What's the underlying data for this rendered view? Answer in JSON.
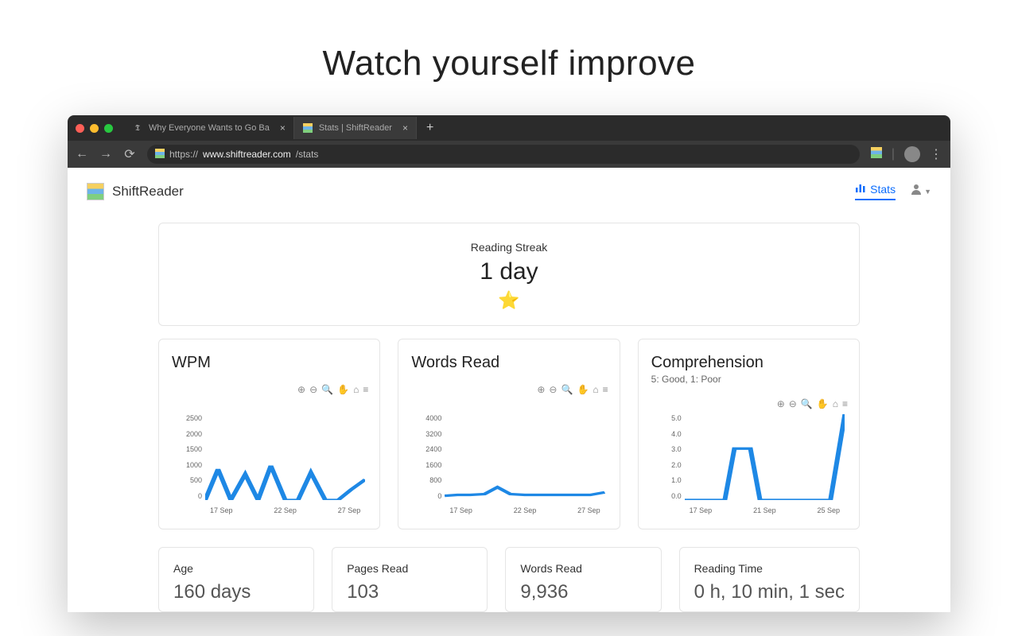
{
  "headline": "Watch yourself improve",
  "browser": {
    "tabs": [
      {
        "title": "Why Everyone Wants to Go Ba",
        "active": false
      },
      {
        "title": "Stats | ShiftReader",
        "active": true
      }
    ],
    "url_prefix": "https://",
    "url_host": "www.shiftreader.com",
    "url_path": "/stats"
  },
  "app": {
    "brand": "ShiftReader",
    "nav_stats": "Stats"
  },
  "streak": {
    "label": "Reading Streak",
    "value": "1 day",
    "star": "⭐"
  },
  "charts": {
    "wpm": {
      "title": "WPM",
      "y_ticks": [
        "2500",
        "2000",
        "1500",
        "1000",
        "500",
        "0"
      ],
      "x_ticks": [
        "17 Sep",
        "22 Sep",
        "27 Sep"
      ]
    },
    "words": {
      "title": "Words Read",
      "y_ticks": [
        "4000",
        "3200",
        "2400",
        "1600",
        "800",
        "0"
      ],
      "x_ticks": [
        "17 Sep",
        "22 Sep",
        "27 Sep"
      ]
    },
    "comp": {
      "title": "Comprehension",
      "subtitle": "5: Good, 1: Poor",
      "y_ticks": [
        "5.0",
        "4.0",
        "3.0",
        "2.0",
        "1.0",
        "0.0"
      ],
      "x_ticks": [
        "17 Sep",
        "21 Sep",
        "25 Sep"
      ]
    }
  },
  "chart_data": [
    {
      "type": "line",
      "title": "WPM",
      "ylabel": "",
      "ylim": [
        0,
        2500
      ],
      "x": [
        "17 Sep",
        "18 Sep",
        "19 Sep",
        "20 Sep",
        "21 Sep",
        "22 Sep",
        "23 Sep",
        "24 Sep",
        "25 Sep",
        "26 Sep",
        "27 Sep",
        "28 Sep",
        "29 Sep"
      ],
      "values": [
        0,
        900,
        0,
        750,
        0,
        1000,
        0,
        0,
        800,
        0,
        0,
        300,
        600
      ]
    },
    {
      "type": "line",
      "title": "Words Read",
      "ylabel": "",
      "ylim": [
        0,
        4000
      ],
      "x": [
        "17 Sep",
        "18 Sep",
        "19 Sep",
        "20 Sep",
        "21 Sep",
        "22 Sep",
        "23 Sep",
        "24 Sep",
        "25 Sep",
        "26 Sep",
        "27 Sep",
        "28 Sep",
        "29 Sep"
      ],
      "values": [
        200,
        250,
        250,
        300,
        600,
        300,
        250,
        250,
        250,
        250,
        250,
        250,
        350
      ]
    },
    {
      "type": "line",
      "title": "Comprehension",
      "ylabel": "",
      "ylim": [
        0,
        5
      ],
      "x": [
        "17 Sep",
        "18 Sep",
        "19 Sep",
        "20 Sep",
        "21 Sep",
        "22 Sep",
        "23 Sep",
        "24 Sep",
        "25 Sep",
        "26 Sep",
        "27 Sep",
        "28 Sep",
        "29 Sep"
      ],
      "values": [
        0,
        0,
        0,
        0,
        3.0,
        3.0,
        0,
        0,
        0,
        0,
        0,
        0,
        5.0
      ]
    }
  ],
  "stats": {
    "age": {
      "label": "Age",
      "value": "160 days"
    },
    "pages": {
      "label": "Pages Read",
      "value": "103"
    },
    "words": {
      "label": "Words Read",
      "value": "9,936"
    },
    "time": {
      "label": "Reading Time",
      "value": "0 h, 10 min, 1 sec"
    }
  },
  "toolbar_icons": {
    "zoom_in": "⊕",
    "zoom_out": "⊖",
    "zoom": "🔍",
    "pan": "✋",
    "home": "⌂",
    "menu": "≡"
  }
}
